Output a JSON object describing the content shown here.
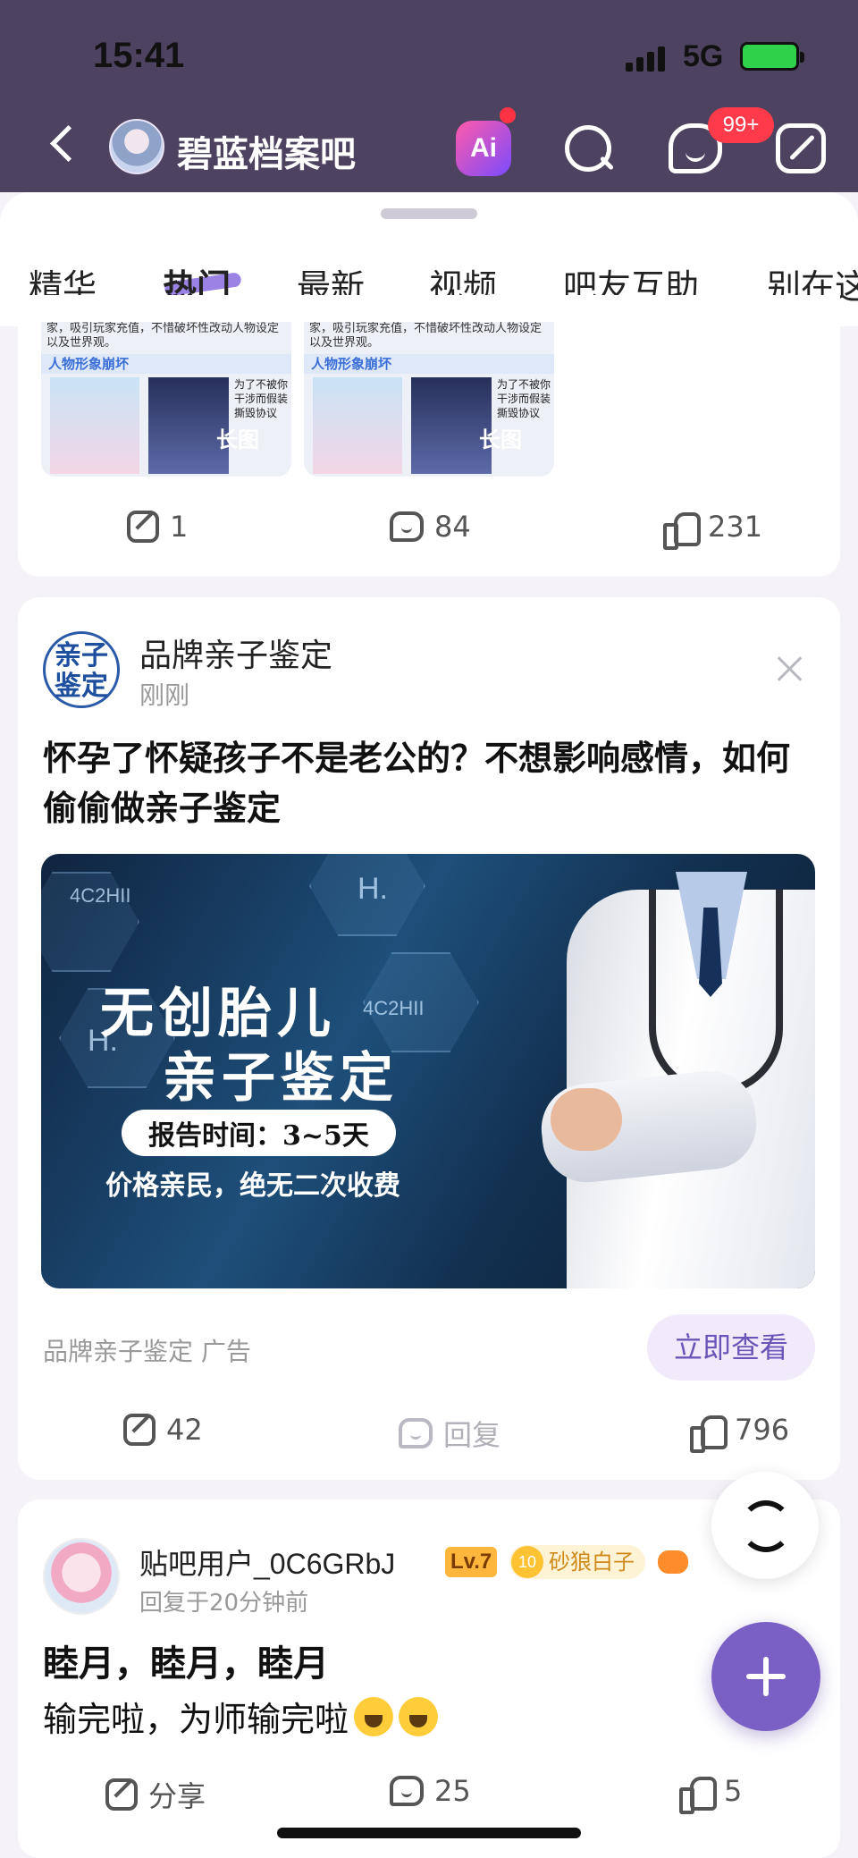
{
  "status_bar": {
    "time": "15:41",
    "network": "5G"
  },
  "header": {
    "title": "碧蓝档案吧",
    "ai_label": "Ai",
    "message_badge": "99+"
  },
  "tabs": [
    {
      "label": "精华"
    },
    {
      "label": "热门"
    },
    {
      "label": "最新"
    },
    {
      "label": "视频"
    },
    {
      "label": "吧友互助"
    },
    {
      "label": "别在这"
    }
  ],
  "active_tab": "热门",
  "post1": {
    "thumb_text": "家，吸引玩家充值，不惜破坏性改动人物设定以及世界观。",
    "thumb_band": "人物形象崩坏",
    "thumb_side": "为了不被你干涉而假装撕毁协议",
    "thumb_label": "长图",
    "share_count": "1",
    "comment_count": "84",
    "like_count": "231"
  },
  "ad": {
    "logo_text": "亲子鉴定",
    "name": "品牌亲子鉴定",
    "time": "刚刚",
    "title": "怀孕了怀疑孩子不是老公的？不想影响感情，如何偷偷做亲子鉴定",
    "banner_code_1": "4C2HII",
    "banner_code_2": "H.",
    "banner_code_3": "4C2HII",
    "banner_code_4": "H.",
    "banner_heading_1": "无创胎儿",
    "banner_heading_2": "亲子鉴定",
    "banner_pill": "报告时间：3~5天",
    "banner_line": "价格亲民，绝无二次收费",
    "source": "品牌亲子鉴定  广告",
    "cta": "立即查看",
    "share_count": "42",
    "reply_label": "回复",
    "like_count": "796"
  },
  "post3": {
    "username": "贴吧用户_0C6GRbJ",
    "level": "Lv.7",
    "badge_level": "10",
    "badge_title": "砂狼白子",
    "time": "回复于20分钟前",
    "title": "睦月，睦月，睦月",
    "body": "输完啦，为师输完啦",
    "share_label": "分享",
    "comment_count": "25",
    "like_count": "5"
  }
}
